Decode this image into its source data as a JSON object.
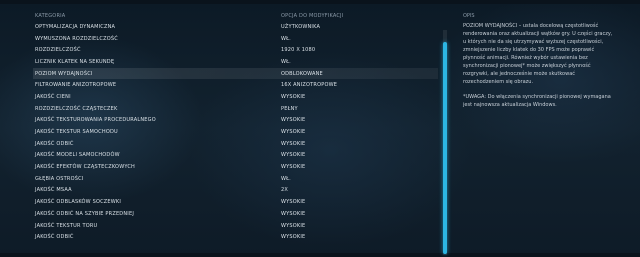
{
  "columns": {
    "category": "KATEGORIA",
    "option": "OPCJA DO MODYFIKACJI",
    "description": "OPIS"
  },
  "rows": [
    {
      "category": "OPTYMALIZACJA DYNAMICZNA",
      "option": "UŻYTKOWNIKA"
    },
    {
      "category": "WYMUSZONA ROZDZIELCZOŚĆ",
      "option": "WŁ."
    },
    {
      "category": "ROZDZIELCZOŚĆ",
      "option": "1920 x 1080"
    },
    {
      "category": "LICZNIK KLATEK NA SEKUNDĘ",
      "option": "WŁ."
    },
    {
      "category": "POZIOM WYDAJNOŚCI",
      "option": "ODBLOKOWANE"
    },
    {
      "category": "FILTROWANIE ANIZOTROPOWE",
      "option": "16x ANIZOTROPOWE"
    },
    {
      "category": "JAKOŚĆ CIENI",
      "option": "WYSOKIE"
    },
    {
      "category": "ROZDZIELCZOŚĆ CZĄSTECZEK",
      "option": "PEŁNY"
    },
    {
      "category": "JAKOŚĆ TEKSTUROWANIA PROCEDURALNEGO",
      "option": "WYSOKIE"
    },
    {
      "category": "JAKOŚĆ TEKSTUR SAMOCHODU",
      "option": "WYSOKIE"
    },
    {
      "category": "JAKOŚĆ ODBIĆ",
      "option": "WYSOKIE"
    },
    {
      "category": "JAKOŚĆ MODELI SAMOCHODÓW",
      "option": "WYSOKIE"
    },
    {
      "category": "JAKOŚĆ EFEKTÓW CZĄSTECZKOWYCH",
      "option": "WYSOKIE"
    },
    {
      "category": "GŁĘBIA OSTROŚCI",
      "option": "WŁ."
    },
    {
      "category": "JAKOŚĆ MSAA",
      "option": "2x"
    },
    {
      "category": "JAKOŚĆ ODBLASKÓW SOCZEWKI",
      "option": "WYSOKIE"
    },
    {
      "category": "JAKOŚĆ ODBIĆ NA SZYBIE PRZEDNIEJ",
      "option": "WYSOKIE"
    },
    {
      "category": "JAKOŚĆ TEKSTUR TORU",
      "option": "WYSOKIE"
    },
    {
      "category": "JAKOŚĆ ODBIĆ",
      "option": "WYSOKIE"
    }
  ],
  "selected_row_index": 4,
  "description": {
    "text": "POZIOM WYDAJNOŚCI – ustala docelową częstotliwość renderowania oraz aktualizacji wątków gry. U części graczy, u których nie da się utrzymywać wyższej częstotliwości, zmniejszenie liczby klatek do 30 FPS może poprawić płynność animacji. Również wybór ustawienia bez synchronizacji pionowej* może zwiększyć płynność rozgrywki, ale jednocześnie może skutkować rozechodzeniem się obrazu.",
    "note": "*UWAGA: Do włączenia synchronizacji pionowej wymagana jest najnowsza aktualizacja Windows."
  },
  "scroll_position": 0.0,
  "colors": {
    "accent": "#2cb6e3",
    "background": "#0f1d2a",
    "text": "#d9e0e6",
    "header_text": "#8b9aa8"
  }
}
